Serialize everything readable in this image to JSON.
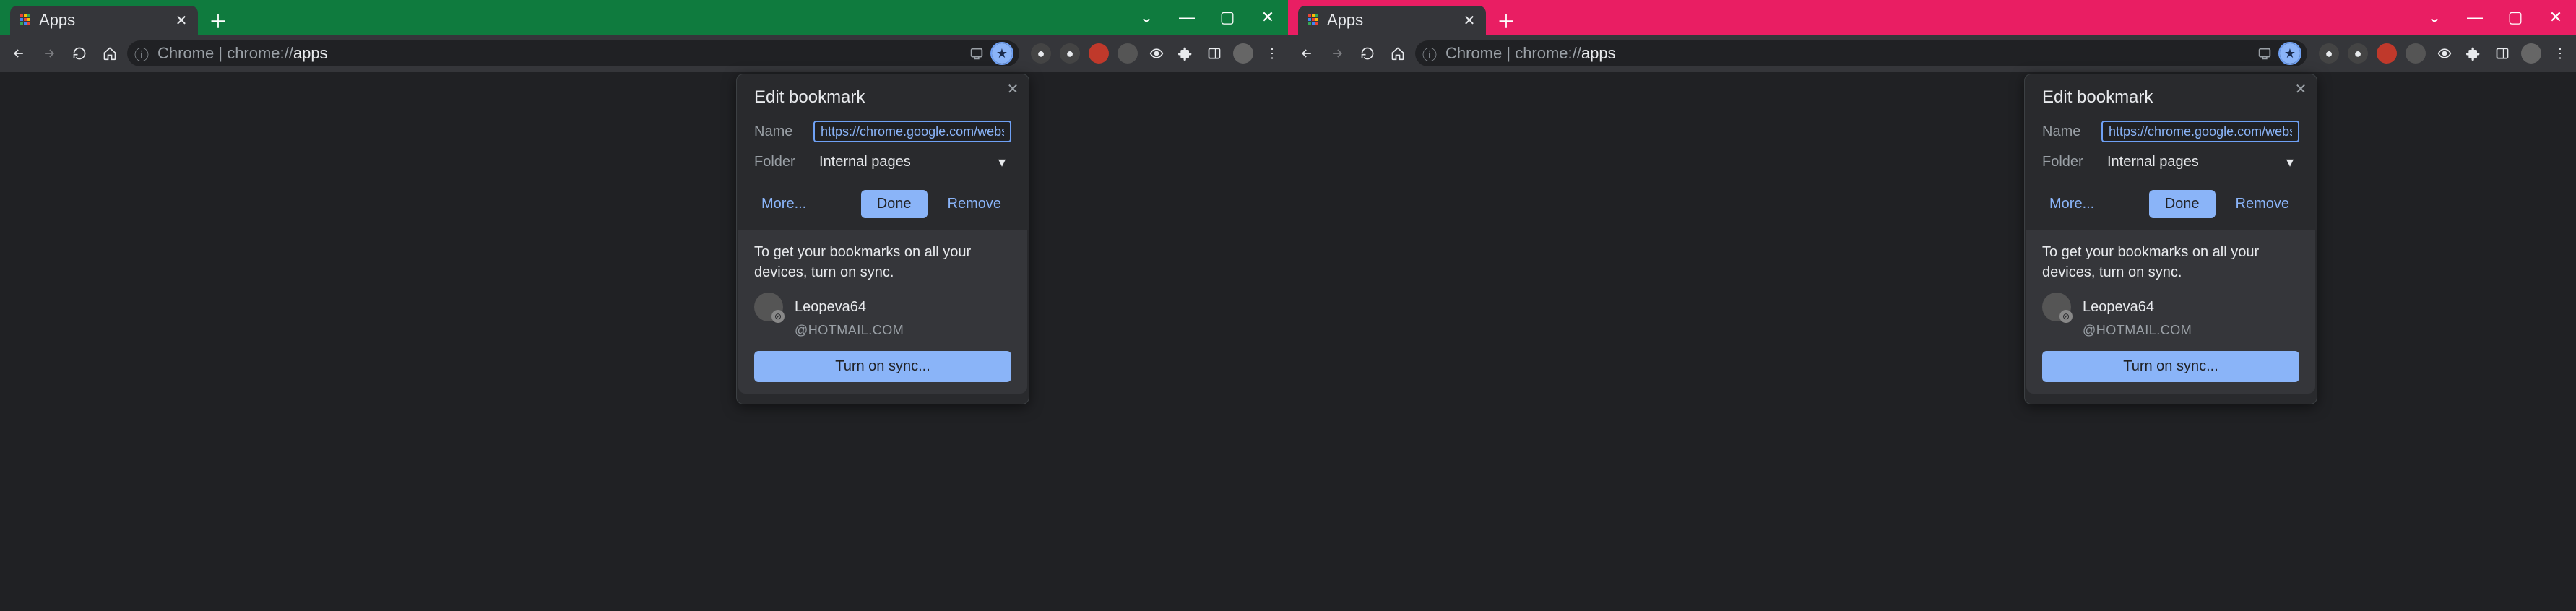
{
  "windows": [
    {
      "theme": "green",
      "tab": {
        "title": "Apps"
      },
      "url": {
        "prefix": "Chrome | ",
        "path": "chrome://",
        "bold": "apps"
      },
      "popup": {
        "title": "Edit bookmark",
        "name_label": "Name",
        "name_value": "https://chrome.google.com/webstore/deta",
        "folder_label": "Folder",
        "folder_value": "Internal pages",
        "more": "More...",
        "done": "Done",
        "remove": "Remove",
        "sync_msg": "To get your bookmarks on all your devices, turn on sync.",
        "user_name": "Leopeva64",
        "user_email": "@HOTMAIL.COM",
        "sync_btn": "Turn on sync..."
      }
    },
    {
      "theme": "pink",
      "tab": {
        "title": "Apps"
      },
      "url": {
        "prefix": "Chrome | ",
        "path": "chrome://",
        "bold": "apps"
      },
      "popup": {
        "title": "Edit bookmark",
        "name_label": "Name",
        "name_value": "https://chrome.google.com/webstore/deta",
        "folder_label": "Folder",
        "folder_value": "Internal pages",
        "more": "More...",
        "done": "Done",
        "remove": "Remove",
        "sync_msg": "To get your bookmarks on all your devices, turn on sync.",
        "user_name": "Leopeva64",
        "user_email": "@HOTMAIL.COM",
        "sync_btn": "Turn on sync..."
      }
    }
  ]
}
